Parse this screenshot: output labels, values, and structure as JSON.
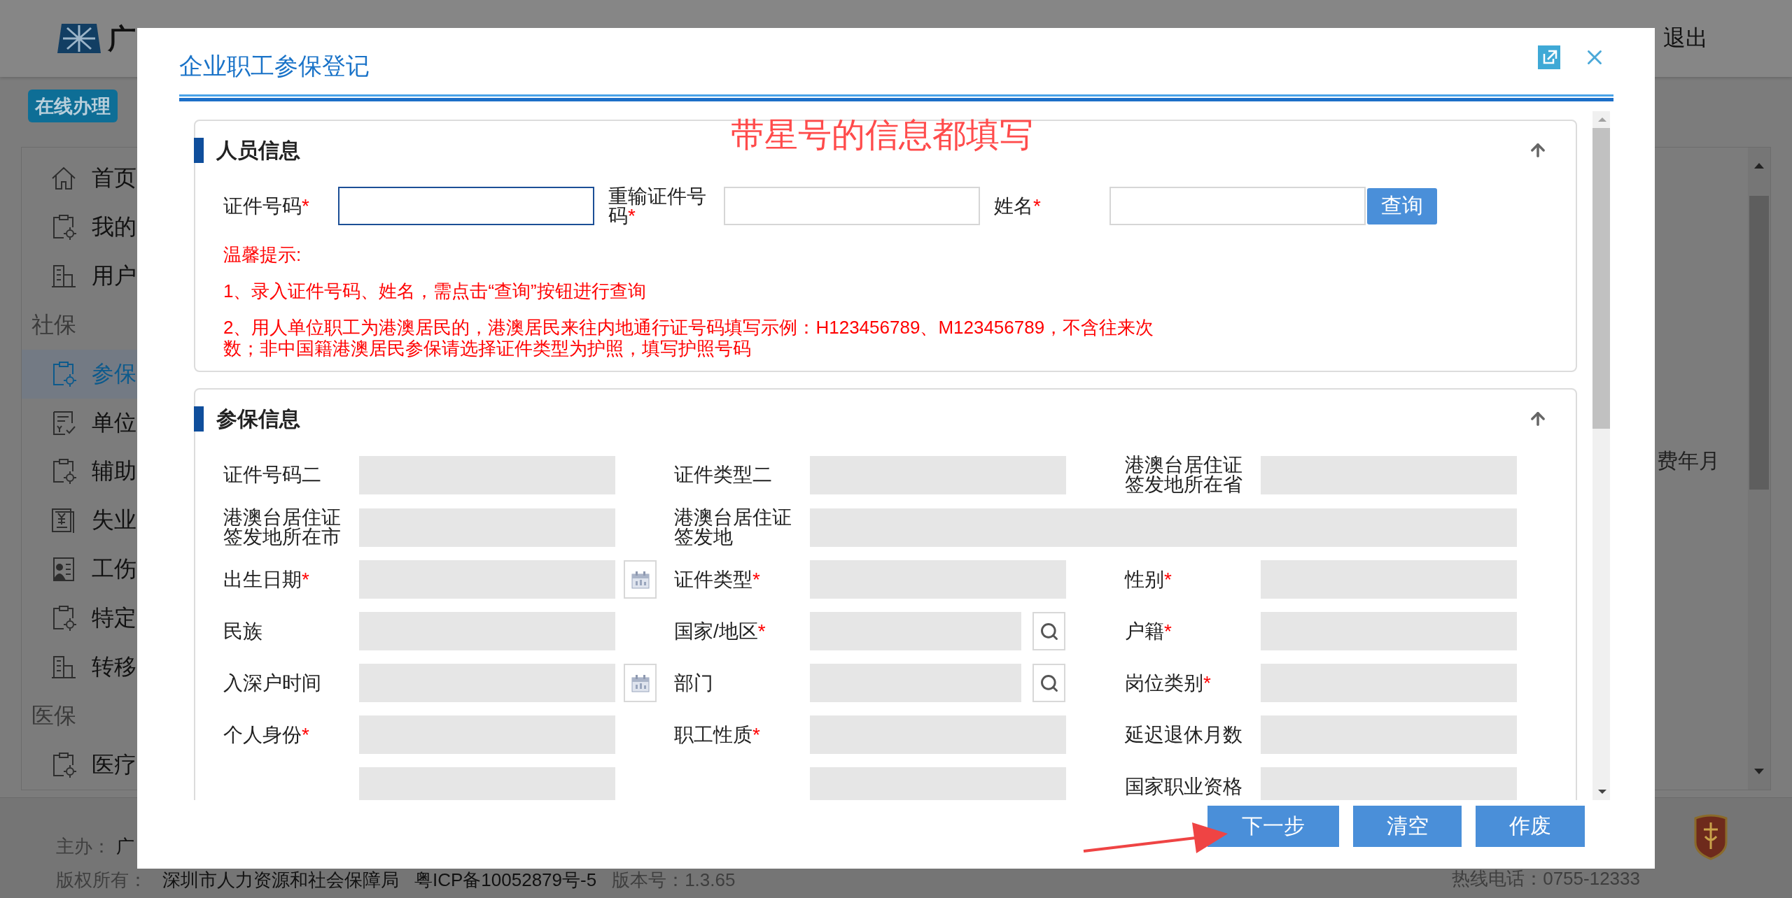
{
  "header": {
    "logo_text": "广",
    "logout": "退出"
  },
  "badge": "在线办理",
  "sidebar": [
    {
      "kind": "item",
      "label": "首页",
      "selected": false
    },
    {
      "kind": "item",
      "label": "我的",
      "selected": false
    },
    {
      "kind": "item",
      "label": "用户",
      "selected": false
    },
    {
      "kind": "group",
      "label": "社保",
      "selected": false
    },
    {
      "kind": "item",
      "label": "参保",
      "selected": true
    },
    {
      "kind": "item",
      "label": "单位",
      "selected": false
    },
    {
      "kind": "item",
      "label": "辅助",
      "selected": false
    },
    {
      "kind": "item",
      "label": "失业",
      "selected": false
    },
    {
      "kind": "item",
      "label": "工伤",
      "selected": false
    },
    {
      "kind": "item",
      "label": "特定",
      "selected": false
    },
    {
      "kind": "item",
      "label": "转移",
      "selected": false
    },
    {
      "kind": "group",
      "label": "医保",
      "selected": false
    },
    {
      "kind": "item",
      "label": "医疗",
      "selected": false
    }
  ],
  "side_panel": {
    "text": "费年月"
  },
  "footer": {
    "sponsor_label": "主办：",
    "sponsor": "广",
    "copyright_label": "版权所有：",
    "copyright": "深圳市人力资源和社会保障局",
    "icp": "粤ICP备10052879号-5",
    "version": "版本号：1.3.65",
    "hotline": "热线电话：0755-12333"
  },
  "dialog": {
    "title": "企业职工参保登记",
    "annotation": "带星号的信息都填写",
    "person_section": {
      "title": "人员信息",
      "fields": [
        {
          "label": "证件号码",
          "required_mark": "*",
          "focused": true
        },
        {
          "label": "重输证件号码",
          "required_mark": "*",
          "focused": false
        },
        {
          "label": "姓名",
          "required_mark": "*",
          "focused": false
        }
      ],
      "query_button": "查询",
      "tips_title": "温馨提示:",
      "tips": [
        "1、录入证件号码、姓名，需点击“查询”按钮进行查询",
        "2、用人单位职工为港澳居民的，港澳居民来往内地通行证号码填写示例：H123456789、M123456789，不含往来次数；非中国籍港澳居民参保请选择证件类型为护照，填写护照号码"
      ]
    },
    "insurance_section": {
      "title": "参保信息",
      "rows": [
        [
          {
            "label": "证件号码二",
            "kind": "plain"
          },
          {
            "label": "证件类型二",
            "kind": "plain"
          },
          {
            "label": "港澳台居住证签发地所在省",
            "kind": "plain"
          }
        ],
        [
          {
            "label": "港澳台居住证签发地所在市",
            "kind": "plain"
          },
          {
            "label": "港澳台居住证签发地",
            "kind": "wide"
          }
        ],
        [
          {
            "label": "出生日期",
            "required_mark": "*",
            "kind": "date"
          },
          {
            "label": "证件类型",
            "required_mark": "*",
            "kind": "plain"
          },
          {
            "label": "性别",
            "required_mark": "*",
            "kind": "plain"
          }
        ],
        [
          {
            "label": "民族",
            "kind": "plain"
          },
          {
            "label": "国家/地区",
            "required_mark": "*",
            "kind": "lookup"
          },
          {
            "label": "户籍",
            "required_mark": "*",
            "kind": "plain"
          }
        ],
        [
          {
            "label": "入深户时间",
            "kind": "date"
          },
          {
            "label": "部门",
            "kind": "lookup"
          },
          {
            "label": "岗位类别",
            "required_mark": "*",
            "kind": "plain"
          }
        ],
        [
          {
            "label": "个人身份",
            "required_mark": "*",
            "kind": "plain"
          },
          {
            "label": "职工性质",
            "required_mark": "*",
            "kind": "plain"
          },
          {
            "label": "延迟退休月数",
            "kind": "plain"
          }
        ],
        [
          {
            "kind": "plain"
          },
          {
            "kind": "plain"
          },
          {
            "label": "国家职业资格",
            "kind": "plain"
          }
        ]
      ]
    },
    "buttons": [
      "下一步",
      "清空",
      "作废"
    ]
  }
}
